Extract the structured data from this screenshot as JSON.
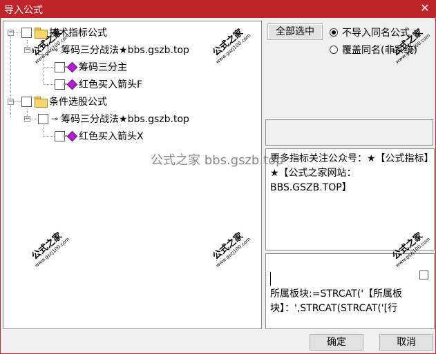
{
  "window": {
    "title": "导入公式"
  },
  "tree": {
    "nodes": [
      {
        "label": "技术指标公式"
      },
      {
        "label": "筹码三分战法★bbs.gszb.top"
      },
      {
        "label": "筹码三分主"
      },
      {
        "label": "红色买入箭头F"
      },
      {
        "label": "条件选股公式"
      },
      {
        "label": "筹码三分战法★bbs.gszb.top"
      },
      {
        "label": "红色买入箭头X"
      }
    ]
  },
  "controls": {
    "select_all": "全部选中",
    "radio_skip": "不导入同名公式",
    "radio_overwrite": "覆盖同名(非系统)"
  },
  "info": {
    "text": "更多指标关注公众号：★【公式指标】★【公式之家网站：BBS.GSZB.TOP】"
  },
  "code": {
    "text": "所属板块:=STRCAT('【所属板块】：',STRCAT(STRCAT('[行"
  },
  "buttons": {
    "ok": "确定",
    "cancel": "取消"
  },
  "watermarks": {
    "center": "公式之家 bbs.gszb.top",
    "stamp_big": "公式之家",
    "stamp_small": "www.gszj100.com"
  }
}
